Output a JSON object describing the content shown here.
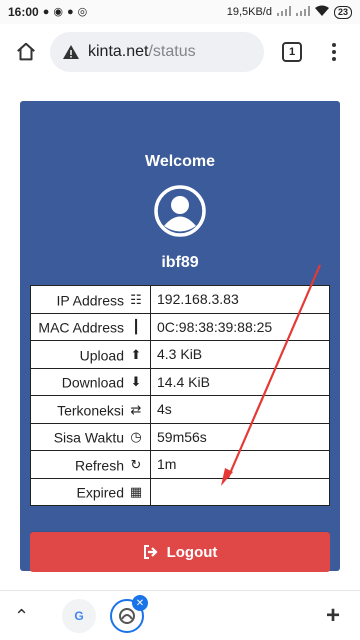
{
  "statusbar": {
    "time": "16:00",
    "network_speed": "19,5KB/d",
    "battery": "23"
  },
  "browser": {
    "url_host": "kinta.net",
    "url_path": "/status",
    "tab_count": "1"
  },
  "card": {
    "welcome": "Welcome",
    "username": "ibf89",
    "bg_color": "#3c5b9a",
    "rows": [
      {
        "label": "IP Address",
        "icon": "sitemap-icon",
        "value": "192.168.3.83"
      },
      {
        "label": "MAC Address",
        "icon": "barcode-icon",
        "value": "0C:98:38:39:88:25"
      },
      {
        "label": "Upload",
        "icon": "upload-icon",
        "value": "4.3 KiB"
      },
      {
        "label": "Download",
        "icon": "download-icon",
        "value": "14.4 KiB"
      },
      {
        "label": "Terkoneksi",
        "icon": "exchange-icon",
        "value": "4s"
      },
      {
        "label": "Sisa Waktu",
        "icon": "clock-icon",
        "value": "59m56s"
      },
      {
        "label": "Refresh",
        "icon": "refresh-icon",
        "value": "1m"
      },
      {
        "label": "Expired",
        "icon": "calendar-icon",
        "value": ""
      }
    ],
    "logout_label": "Logout",
    "logout_color": "#e04848"
  },
  "annotation": {
    "arrow_color": "#e53935"
  },
  "bottombar": {
    "tab1_letter": "G"
  }
}
